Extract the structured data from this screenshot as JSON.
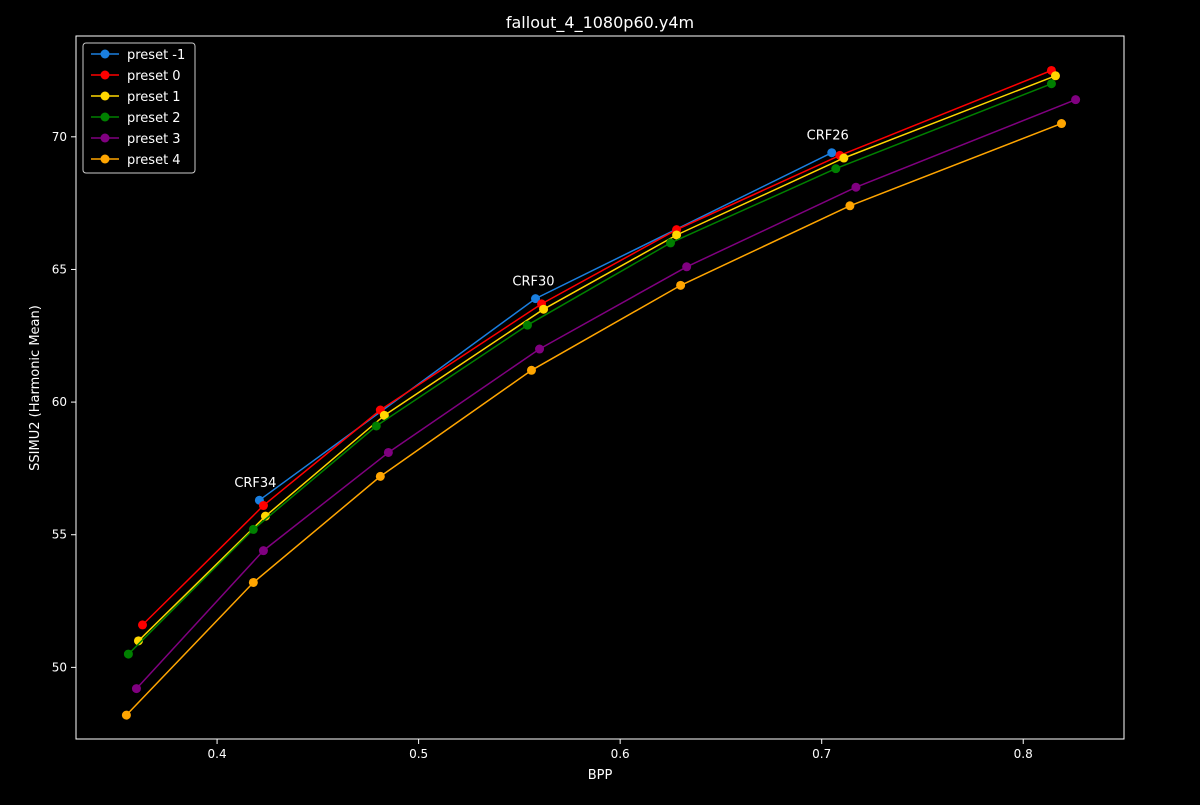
{
  "chart_data": {
    "type": "line",
    "title": "fallout_4_1080p60.y4m",
    "xlabel": "BPP",
    "ylabel": "SSIMU2 (Harmonic Mean)",
    "xlim": [
      0.33,
      0.85
    ],
    "ylim": [
      47.3,
      73.8
    ],
    "xticks": [
      0.4,
      0.5,
      0.6,
      0.7,
      0.8
    ],
    "xtick_labels": [
      "0.4",
      "0.5",
      "0.6",
      "0.7",
      "0.8"
    ],
    "yticks": [
      50,
      55,
      60,
      65,
      70
    ],
    "ytick_labels": [
      "50",
      "55",
      "60",
      "65",
      "70"
    ],
    "grid": false,
    "legend_position": "upper-left",
    "background": "#000000",
    "series": [
      {
        "name": "preset -1",
        "color": "#1a7fe0",
        "x": [
          0.421,
          0.558,
          0.705
        ],
        "y": [
          56.3,
          63.9,
          69.4
        ]
      },
      {
        "name": "preset 0",
        "color": "#ff0000",
        "x": [
          0.363,
          0.423,
          0.481,
          0.561,
          0.628,
          0.709,
          0.814
        ],
        "y": [
          51.6,
          56.1,
          59.7,
          63.7,
          66.5,
          69.3,
          72.5
        ]
      },
      {
        "name": "preset 1",
        "color": "#ffd700",
        "x": [
          0.361,
          0.424,
          0.483,
          0.562,
          0.628,
          0.711,
          0.816
        ],
        "y": [
          51.0,
          55.7,
          59.5,
          63.5,
          66.3,
          69.2,
          72.3
        ]
      },
      {
        "name": "preset 2",
        "color": "#008000",
        "x": [
          0.356,
          0.418,
          0.479,
          0.554,
          0.625,
          0.707,
          0.814
        ],
        "y": [
          50.5,
          55.2,
          59.1,
          62.9,
          66.0,
          68.8,
          72.0
        ]
      },
      {
        "name": "preset 3",
        "color": "#800080",
        "x": [
          0.36,
          0.423,
          0.485,
          0.56,
          0.633,
          0.717,
          0.826
        ],
        "y": [
          49.2,
          54.4,
          58.1,
          62.0,
          65.1,
          68.1,
          71.4
        ]
      },
      {
        "name": "preset 4",
        "color": "#ffa500",
        "x": [
          0.355,
          0.418,
          0.481,
          0.556,
          0.63,
          0.714,
          0.819
        ],
        "y": [
          48.2,
          53.2,
          57.2,
          61.2,
          64.4,
          67.4,
          70.5
        ]
      }
    ],
    "annotations": [
      {
        "text": "CRF34",
        "x": 0.42,
        "y": 56.3
      },
      {
        "text": "CRF30",
        "x": 0.558,
        "y": 63.9
      },
      {
        "text": "CRF26",
        "x": 0.704,
        "y": 69.4
      }
    ]
  }
}
